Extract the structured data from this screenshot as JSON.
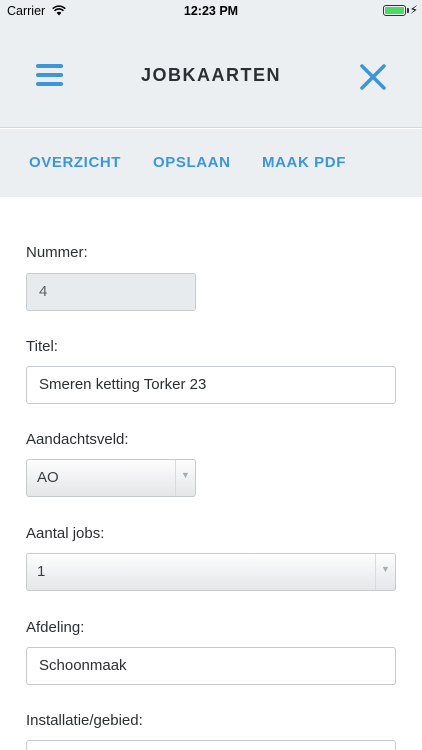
{
  "status_bar": {
    "carrier": "Carrier",
    "time": "12:23 PM",
    "wifi_icon": "wifi-icon",
    "battery_icon": "battery-icon",
    "charging_glyph": "⚡"
  },
  "header": {
    "title": "JOBKAARTEN",
    "menu_icon": "hamburger-menu-icon",
    "close_icon": "close-icon"
  },
  "toolbar": {
    "overview_label": "OVERZICHT",
    "save_label": "OPSLAAN",
    "pdf_label": "MAAK PDF"
  },
  "form": {
    "number": {
      "label": "Nummer:",
      "value": "4"
    },
    "title": {
      "label": "Titel:",
      "value": "Smeren ketting Torker 23"
    },
    "focus_area": {
      "label": "Aandachtsveld:",
      "value": "AO"
    },
    "job_count": {
      "label": "Aantal jobs:",
      "value": "1"
    },
    "department": {
      "label": "Afdeling:",
      "value": "Schoonmaak"
    },
    "installation": {
      "label": "Installatie/gebied:",
      "value": ""
    }
  },
  "colors": {
    "accent": "#3d96dc",
    "header_bg": "#eceff1",
    "text": "#2b2f33",
    "battery": "#4cd964"
  }
}
